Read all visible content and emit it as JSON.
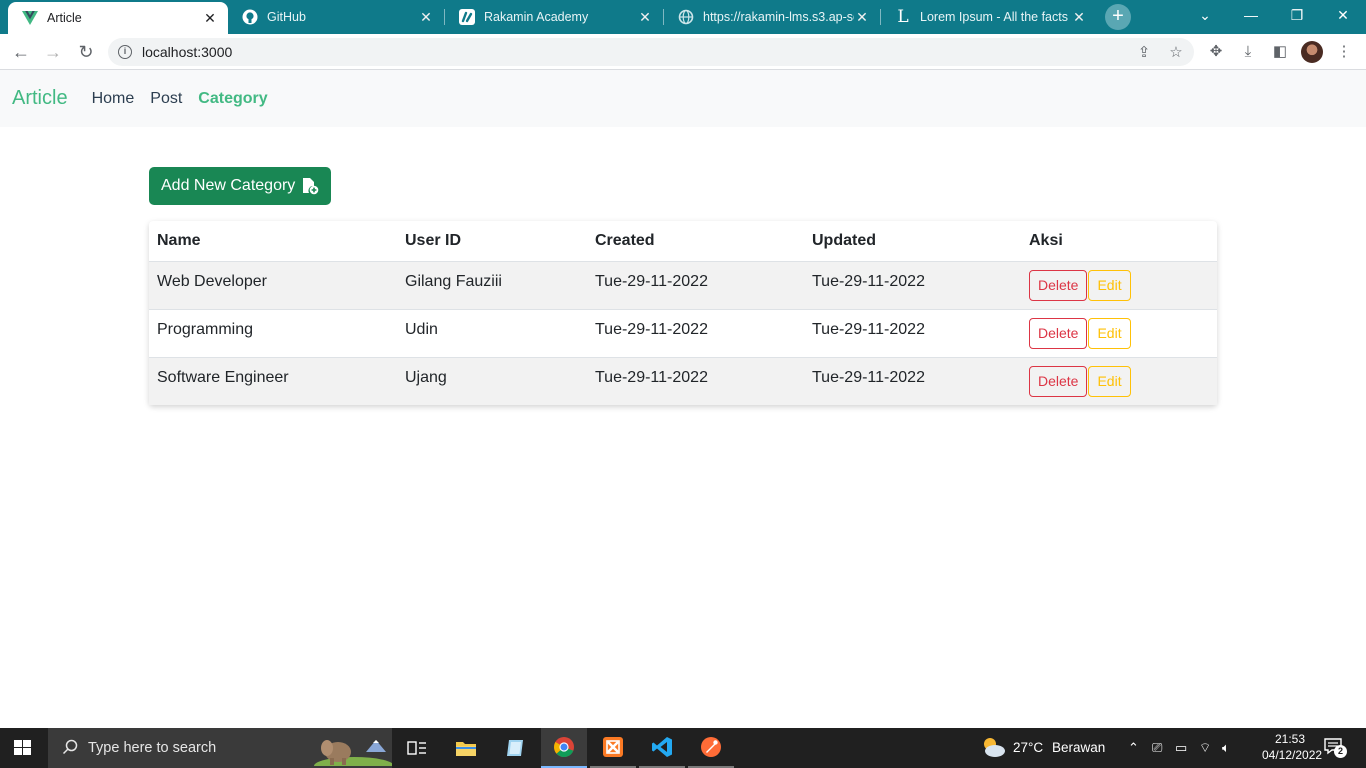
{
  "browser": {
    "tabs": [
      {
        "title": "Article",
        "active": true
      },
      {
        "title": "GitHub",
        "active": false
      },
      {
        "title": "Rakamin Academy",
        "active": false
      },
      {
        "title": "https://rakamin-lms.s3.ap-so",
        "active": false
      },
      {
        "title": "Lorem Ipsum - All the facts -",
        "active": false
      }
    ],
    "url": "localhost:3000",
    "tab_strip_color": "#0f7a8a"
  },
  "app_nav": {
    "brand": "Article",
    "links": [
      "Home",
      "Post",
      "Category"
    ],
    "active_link": "Category",
    "accent_color": "#42b983"
  },
  "main": {
    "add_button_label": "Add New Category",
    "table": {
      "headers": [
        "Name",
        "User ID",
        "Created",
        "Updated",
        "Aksi"
      ],
      "rows": [
        {
          "name": "Web Developer",
          "user_id": "Gilang Fauziii",
          "created": "Tue-29-11-2022",
          "updated": "Tue-29-11-2022"
        },
        {
          "name": "Programming",
          "user_id": "Udin",
          "created": "Tue-29-11-2022",
          "updated": "Tue-29-11-2022"
        },
        {
          "name": "Software Engineer",
          "user_id": "Ujang",
          "created": "Tue-29-11-2022",
          "updated": "Tue-29-11-2022"
        }
      ],
      "delete_label": "Delete",
      "edit_label": "Edit"
    }
  },
  "taskbar": {
    "search_placeholder": "Type here to search",
    "weather_temp": "27°C",
    "weather_text": "Berawan",
    "time": "21:53",
    "date": "04/12/2022",
    "notification_count": "2"
  }
}
